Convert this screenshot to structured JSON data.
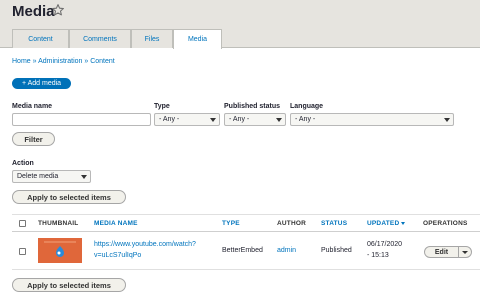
{
  "page": {
    "title": "Media"
  },
  "tabs": [
    {
      "label": "Content",
      "active": false
    },
    {
      "label": "Comments",
      "active": false
    },
    {
      "label": "Files",
      "active": false
    },
    {
      "label": "Media",
      "active": true
    }
  ],
  "breadcrumb": "Home » Administration » Content",
  "add_media_label": "+ Add media",
  "filters": {
    "media_name_label": "Media name",
    "media_name_value": "",
    "type_label": "Type",
    "type_value": "- Any -",
    "status_label": "Published status",
    "status_value": "- Any -",
    "language_label": "Language",
    "language_value": "- Any -",
    "filter_button": "Filter"
  },
  "action": {
    "label": "Action",
    "selected": "Delete media",
    "apply_label": "Apply to selected items"
  },
  "table": {
    "headers": {
      "thumbnail": "THUMBNAIL",
      "media_name": "MEDIA NAME",
      "type": "TYPE",
      "author": "AUTHOR",
      "status": "STATUS",
      "updated": "UPDATED",
      "operations": "OPERATIONS"
    },
    "rows": [
      {
        "name_line1": "https://www.youtube.com/watch?",
        "name_line2": "v=uLcS7ulIqPo",
        "type": "BetterEmbed",
        "author": "admin",
        "status": "Published",
        "updated_line1": "06/17/2020",
        "updated_line2": "- 15:13",
        "operation": "Edit"
      }
    ]
  },
  "bottom_apply_label": "Apply to selected items",
  "colors": {
    "accent": "#0074bd",
    "button_primary": "#0071b8",
    "header_bg": "#e6e4df",
    "thumbnail": "#e0673a"
  }
}
